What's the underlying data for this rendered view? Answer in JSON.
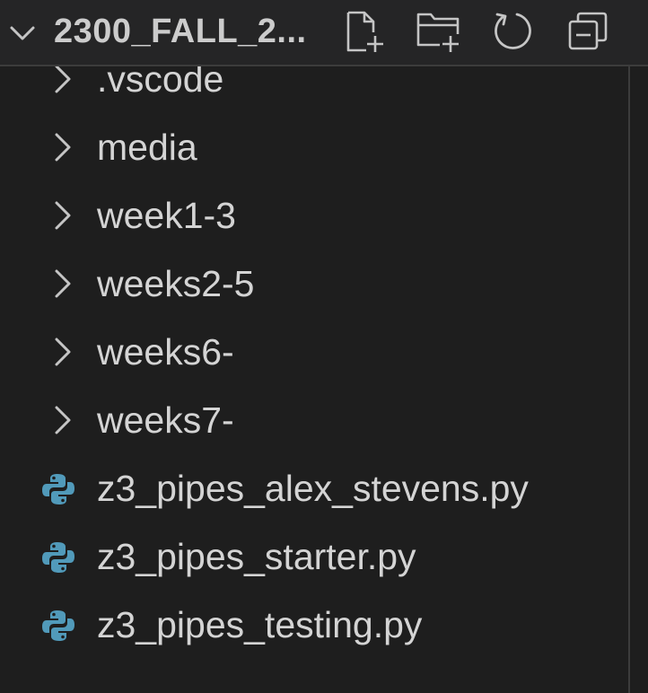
{
  "explorer": {
    "folder_title": "2300_FALL_2...",
    "actions": [
      {
        "name": "new-file-icon"
      },
      {
        "name": "new-folder-icon"
      },
      {
        "name": "refresh-icon"
      },
      {
        "name": "collapse-all-icon"
      }
    ]
  },
  "tree": {
    "items": [
      {
        "label": ".vscode",
        "type": "folder"
      },
      {
        "label": "media",
        "type": "folder"
      },
      {
        "label": "week1-3",
        "type": "folder"
      },
      {
        "label": "weeks2-5",
        "type": "folder"
      },
      {
        "label": "weeks6-",
        "type": "folder"
      },
      {
        "label": "weeks7-",
        "type": "folder"
      },
      {
        "label": "z3_pipes_alex_stevens.py",
        "type": "python-file"
      },
      {
        "label": "z3_pipes_starter.py",
        "type": "python-file"
      },
      {
        "label": "z3_pipes_testing.py",
        "type": "python-file"
      }
    ]
  },
  "colors": {
    "background": "#1e1e1e",
    "header_background": "#252526",
    "text": "#d4d4d4",
    "icon": "#c5c5c5",
    "python_icon": "#519aba"
  }
}
